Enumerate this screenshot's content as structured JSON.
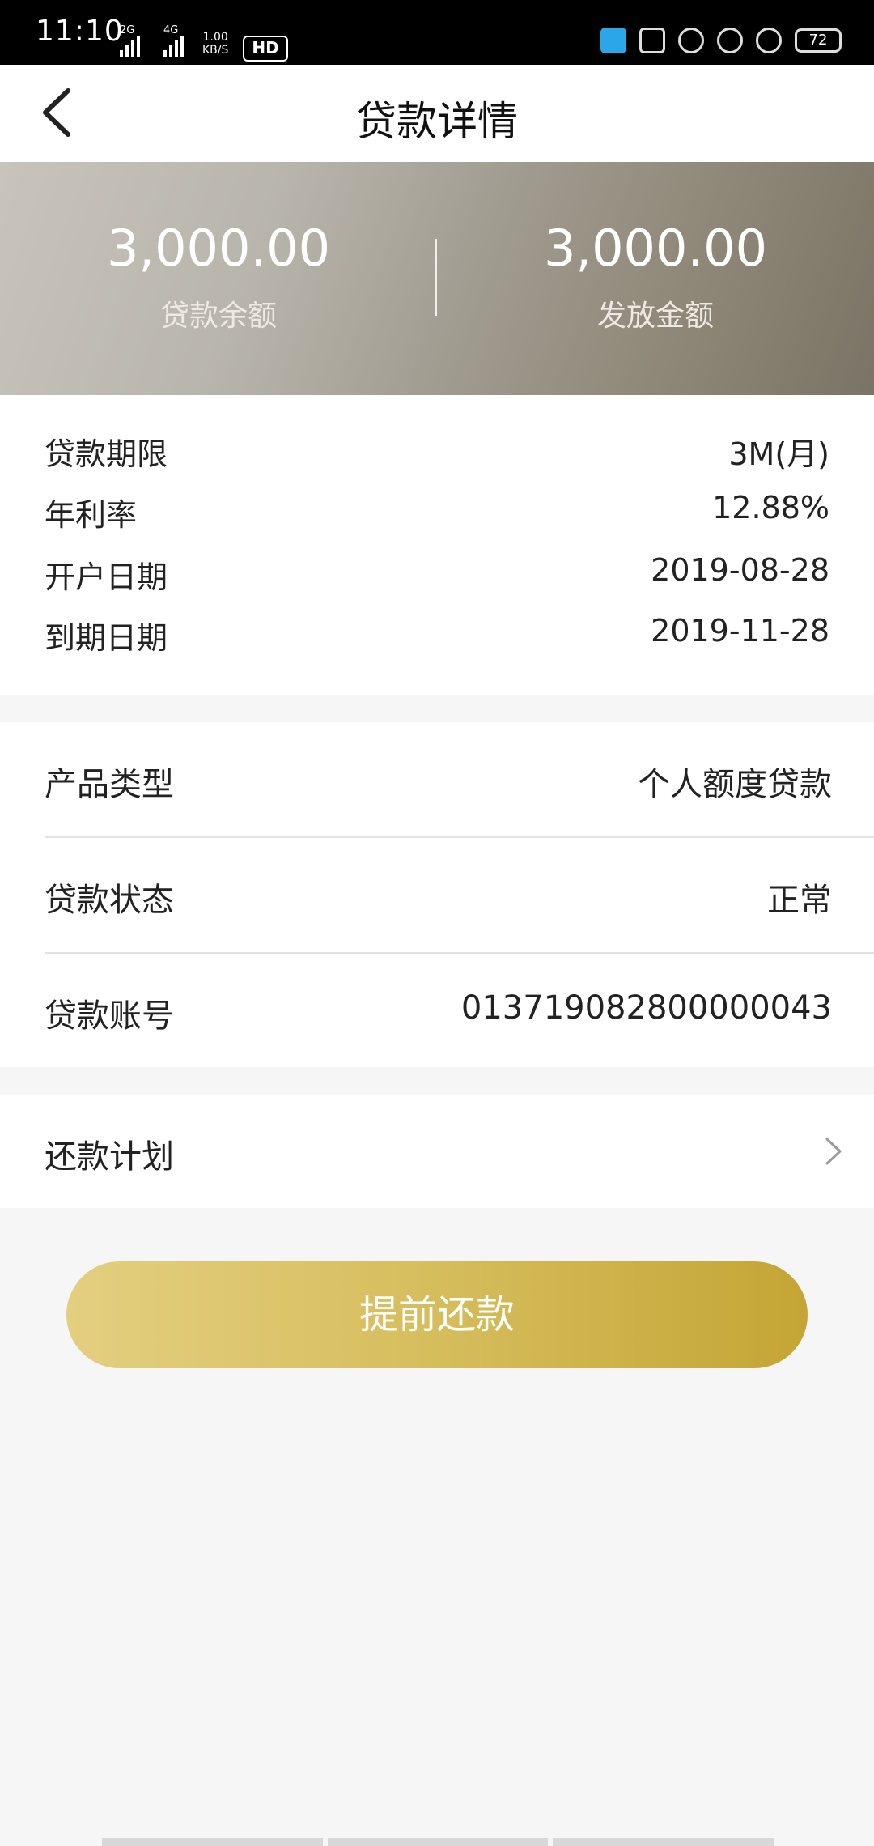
{
  "status_bar": {
    "time": "11:10",
    "net1": "2G",
    "net2": "4G",
    "speed_value": "1.00",
    "speed_unit": "KB/S",
    "hd": "HD",
    "battery": "72"
  },
  "nav": {
    "title": "贷款详情"
  },
  "summary": {
    "balance_amount": "3,000.00",
    "balance_label": "贷款余额",
    "issued_amount": "3,000.00",
    "issued_label": "发放金额"
  },
  "details": [
    {
      "label": "贷款期限",
      "value": "3M(月)"
    },
    {
      "label": "年利率",
      "value": "12.88%"
    },
    {
      "label": "开户日期",
      "value": "2019-08-28"
    },
    {
      "label": "到期日期",
      "value": "2019-11-28"
    }
  ],
  "info": [
    {
      "label": "产品类型",
      "value": "个人额度贷款"
    },
    {
      "label": "贷款状态",
      "value": "正常"
    },
    {
      "label": "贷款账号",
      "value": "013719082800000043"
    }
  ],
  "plan": {
    "label": "还款计划"
  },
  "actions": {
    "prepay_label": "提前还款"
  },
  "colors": {
    "button_gold": "#d6bd5c",
    "card_gray": "#a09b8f"
  }
}
